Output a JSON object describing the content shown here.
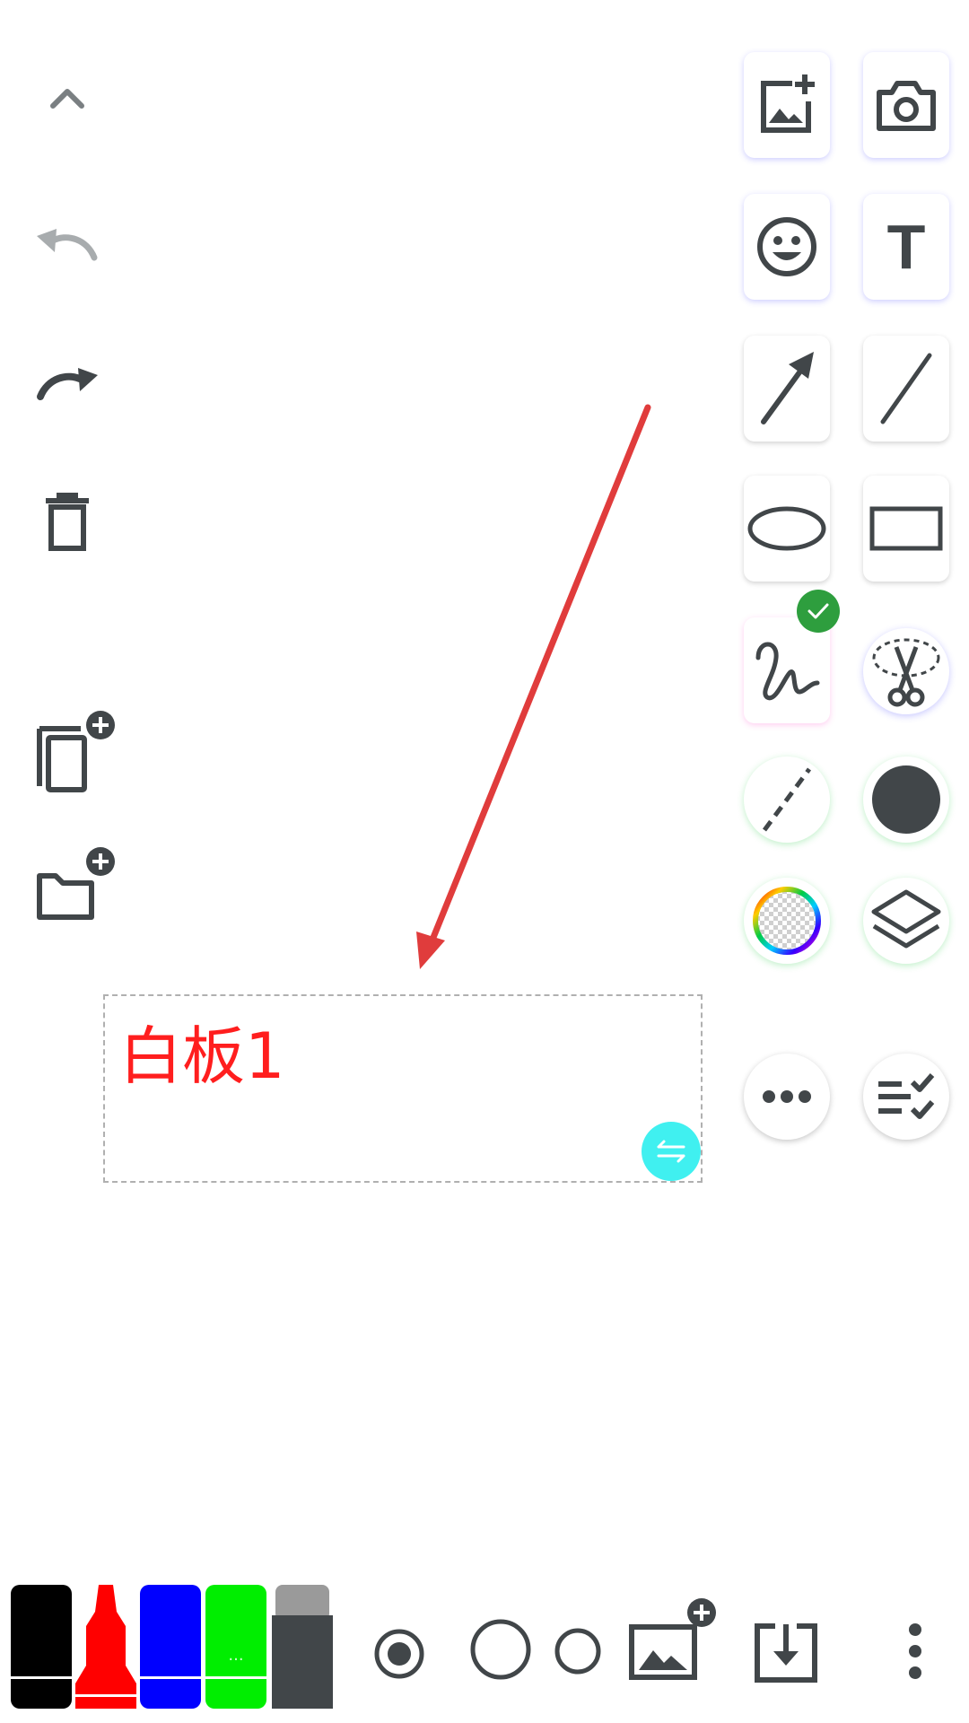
{
  "canvas": {
    "textbox": {
      "text": "白板1",
      "color": "#ff1e1e"
    },
    "arrow": {
      "color": "#e03c3c"
    }
  },
  "left_toolbar": {
    "items": [
      {
        "name": "collapse",
        "icon": "chevron-up-icon"
      },
      {
        "name": "undo",
        "icon": "undo-icon",
        "enabled": false
      },
      {
        "name": "redo",
        "icon": "redo-icon",
        "enabled": true
      },
      {
        "name": "delete",
        "icon": "trash-icon"
      },
      {
        "name": "add-page",
        "icon": "copy-add-icon"
      },
      {
        "name": "add-folder",
        "icon": "folder-add-icon"
      }
    ]
  },
  "right_toolbar": {
    "tools": [
      "add-image-icon",
      "camera-icon",
      "emoji-icon",
      "text-icon",
      "arrow-icon",
      "line-icon",
      "ellipse-icon",
      "rectangle-icon",
      "freehand-icon",
      "lasso-cut-icon",
      "dash-style-icon",
      "fill-color-icon",
      "color-wheel-icon",
      "layers-icon",
      "more-icon",
      "checklist-icon"
    ],
    "selected_tool": "freehand-icon",
    "selected_badge_color": "#2e9e3e",
    "text_tool_label": "T"
  },
  "bottom_bar": {
    "markers": [
      {
        "name": "black-marker",
        "color": "#000000"
      },
      {
        "name": "red-marker",
        "color": "#ff0000"
      },
      {
        "name": "blue-marker",
        "color": "#0000ff"
      },
      {
        "name": "green-marker",
        "color": "#00ee00",
        "label": "..."
      },
      {
        "name": "eraser",
        "color": "#414649"
      }
    ],
    "stroke_sizes": [
      "selected",
      "large",
      "small"
    ],
    "actions": [
      "background-image-icon",
      "save-icon",
      "overflow-menu-icon"
    ]
  }
}
